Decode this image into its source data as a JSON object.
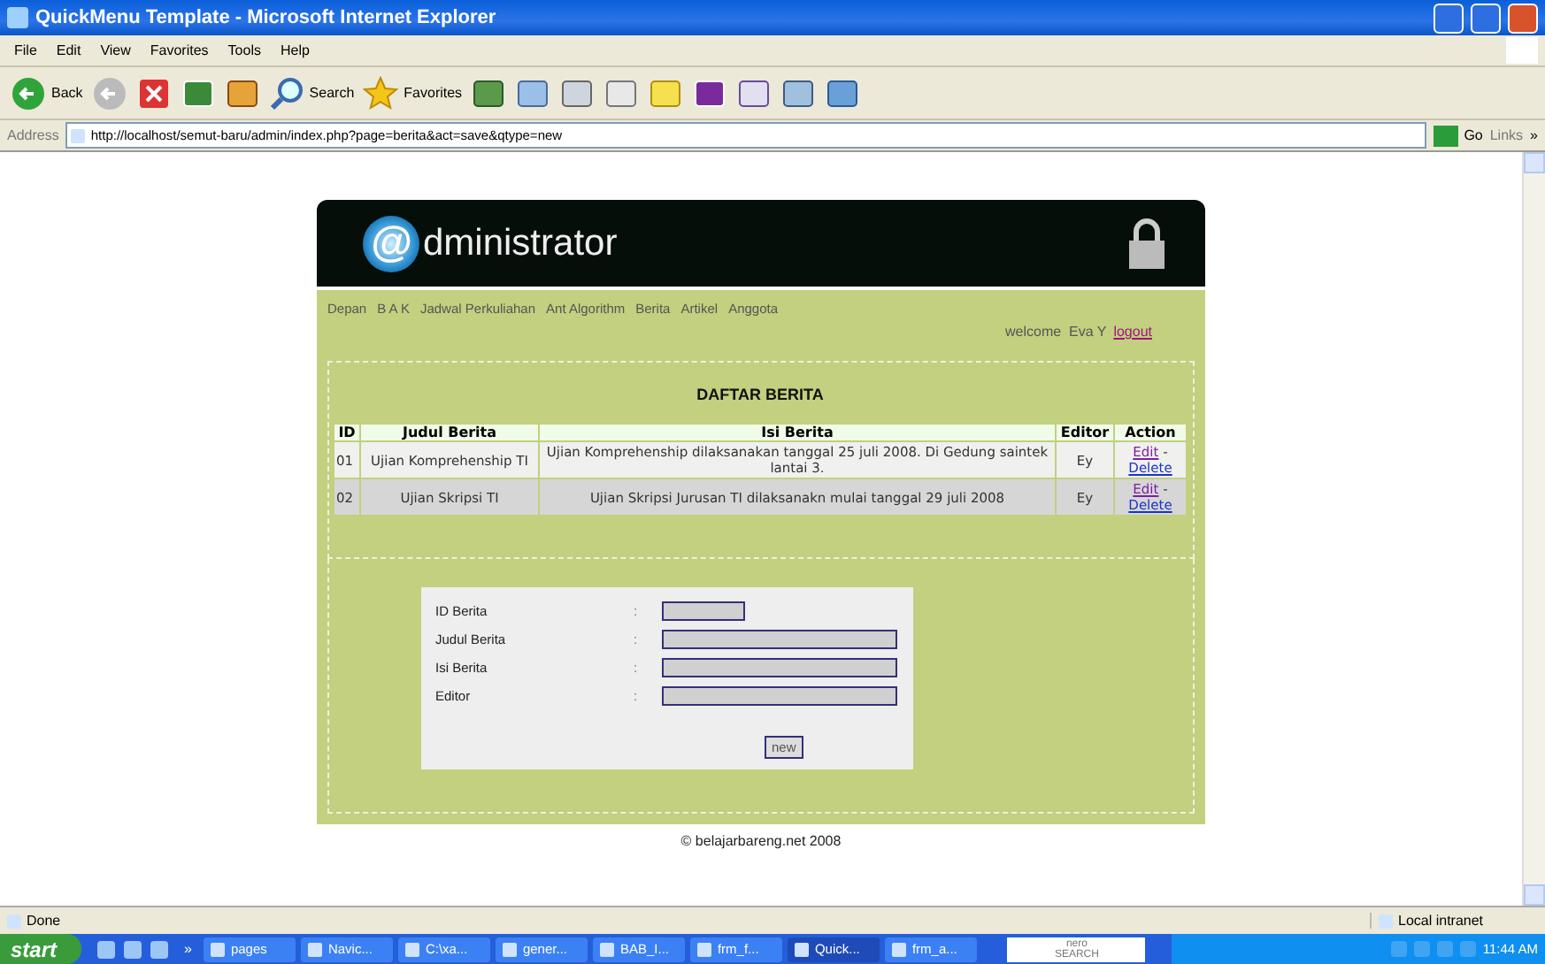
{
  "window": {
    "title": "QuickMenu Template - Microsoft Internet Explorer"
  },
  "menu": [
    "File",
    "Edit",
    "View",
    "Favorites",
    "Tools",
    "Help"
  ],
  "toolbar": {
    "back": "Back",
    "search": "Search",
    "favorites": "Favorites"
  },
  "address": {
    "label": "Address",
    "url": "http://localhost/semut-baru/admin/index.php?page=berita&act=save&qtype=new",
    "go": "Go",
    "links": "Links",
    "more": "»"
  },
  "page": {
    "logo": {
      "mark": "@",
      "text": "dministrator"
    },
    "nav": [
      "Depan",
      "B A K",
      "Jadwal Perkuliahan",
      "Ant Algorithm",
      "Berita",
      "Artikel",
      "Anggota"
    ],
    "welcome": "welcome  Eva Y",
    "logout": "logout",
    "heading": "DAFTAR BERITA",
    "table": {
      "columns": [
        "ID",
        "Judul Berita",
        "Isi Berita",
        "Editor",
        "Action"
      ],
      "rows": [
        {
          "id": "01",
          "judul": "Ujian Komprehenship TI",
          "isi": "Ujian Komprehenship dilaksanakan tanggal 25 juli 2008. Di Gedung saintek lantai 3.",
          "editor": "Ey",
          "edit": "Edit",
          "sep": "-",
          "delete": "Delete"
        },
        {
          "id": "02",
          "judul": "Ujian Skripsi TI",
          "isi": "Ujian Skripsi Jurusan TI dilaksanakn mulai tanggal 29 juli 2008",
          "editor": "Ey",
          "edit": "Edit",
          "sep": "-",
          "delete": "Delete"
        }
      ]
    },
    "form": {
      "fields": [
        {
          "label": "ID Berita",
          "colon": ":",
          "kind": "short"
        },
        {
          "label": "Judul Berita",
          "colon": ":",
          "kind": "long"
        },
        {
          "label": "Isi Berita",
          "colon": ":",
          "kind": "long"
        },
        {
          "label": "Editor",
          "colon": ":",
          "kind": "long"
        }
      ],
      "button": "new"
    },
    "footer": "© belajarbareng.net 2008"
  },
  "status_bar": {
    "text": "Done",
    "zone": "Local intranet"
  },
  "taskbar": {
    "start": "start",
    "more": "»",
    "buttons": [
      {
        "label": "pages",
        "selected": false
      },
      {
        "label": "Navic...",
        "selected": false
      },
      {
        "label": "C:\\xa...",
        "selected": false
      },
      {
        "label": "gener...",
        "selected": false
      },
      {
        "label": "BAB_I...",
        "selected": false
      },
      {
        "label": "frm_f...",
        "selected": false
      },
      {
        "label": "Quick...",
        "selected": true
      },
      {
        "label": "frm_a...",
        "selected": false
      }
    ],
    "search": {
      "brand": "nero",
      "sub": "SEARCH"
    },
    "clock": "11:44 AM"
  }
}
